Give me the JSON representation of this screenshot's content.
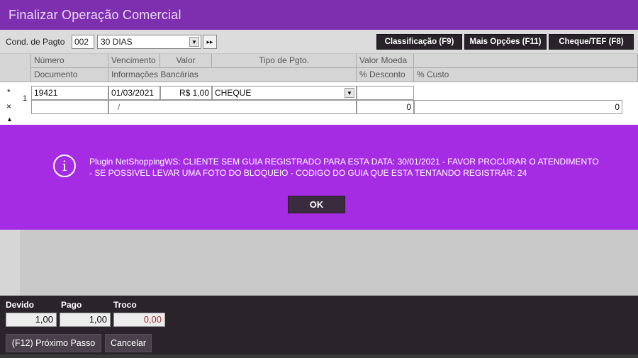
{
  "window": {
    "title": "Finalizar Operação Comercial"
  },
  "toolbar": {
    "cond_label": "Cond. de Pagto",
    "cond_code": "002",
    "cond_value": "30 DIAS",
    "skip_glyph": "▸▸",
    "arrow_glyph": "▼",
    "btn_classificacao": "Classificação (F9)",
    "btn_mais_opcoes": "Mais Opções (F11)",
    "btn_cheque_tef": "Cheque/TEF (F8)"
  },
  "grid": {
    "headers_row1": [
      "Número",
      "Vencimento",
      "Valor",
      "Tipo de Pgto.",
      "Valor Moeda"
    ],
    "headers_row2": [
      "Documento",
      "Informações Bancárias",
      "% Desconto",
      "% Custo"
    ],
    "row_marker_new": "*",
    "row_marker_delete": "×",
    "row_marker_up": "▲",
    "row_index": "1",
    "row": {
      "numero": "19421",
      "vencimento": "01/03/2021",
      "valor": "R$ 1,00",
      "tipo": "CHEQUE",
      "info_bancaria": "/",
      "desconto": "0",
      "custo": "0"
    }
  },
  "message": {
    "text": "Plugin NetShoppingWS: CLIENTE SEM GUIA REGISTRADO PARA ESTA DATA: 30/01/2021 - FAVOR PROCURAR O ATENDIMENTO - SE POSSIVEL LEVAR UMA FOTO DO BLOQUEIO - CODIGO DO GUIA QUE ESTA TENTANDO REGISTRAR: 24",
    "ok_label": "OK",
    "icon_glyph": "i"
  },
  "footer": {
    "devido_label": "Devido",
    "pago_label": "Pago",
    "troco_label": "Troco",
    "devido_value": "1,00",
    "pago_value": "1,00",
    "troco_value": "0,00",
    "btn_proximo": "(F12) Próximo Passo",
    "btn_cancelar": "Cancelar"
  },
  "colors": {
    "titlebar": "#7e2fb0",
    "message_bg": "#a62ce4",
    "footer_bg": "#2b232c",
    "troco_text": "#a03030"
  }
}
